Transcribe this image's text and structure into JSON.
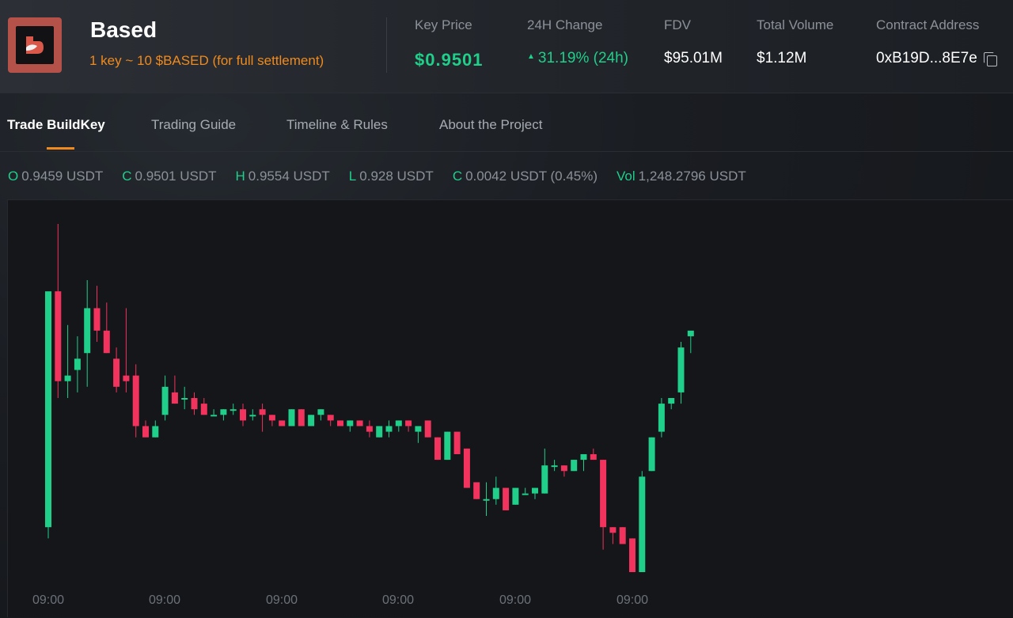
{
  "header": {
    "title": "Based",
    "subtitle": "1 key ~ 10 $BASED (for full settlement)",
    "stats": [
      {
        "label": "Key Price",
        "value": "$0.9501"
      },
      {
        "label": "24H Change",
        "value": "31.19% (24h)"
      },
      {
        "label": "FDV",
        "value": "$95.01M"
      },
      {
        "label": "Total Volume",
        "value": "$1.12M"
      },
      {
        "label": "Contract Address",
        "value": "0xB19D...8E7e"
      }
    ]
  },
  "tabs": [
    {
      "label": "Trade BuildKey",
      "active": true
    },
    {
      "label": "Trading Guide",
      "active": false
    },
    {
      "label": "Timeline & Rules",
      "active": false
    },
    {
      "label": "About the Project",
      "active": false
    }
  ],
  "ohlc": {
    "open": {
      "key": "O",
      "value": "0.9459 USDT"
    },
    "close": {
      "key": "C",
      "value": "0.9501 USDT"
    },
    "high": {
      "key": "H",
      "value": "0.9554 USDT"
    },
    "low": {
      "key": "L",
      "value": "0.928 USDT"
    },
    "change": {
      "key": "C",
      "value": "0.0042 USDT (0.45%)"
    },
    "volume": {
      "key": "Vol",
      "value": "1,248.2796 USDT"
    }
  },
  "colors": {
    "up": "#1fcf8a",
    "down": "#f2335d",
    "accent": "#f08a1c",
    "logo": "#b4524a"
  },
  "chart_data": {
    "type": "candlestick",
    "x_tick_labels": [
      "09:00",
      "09:00",
      "09:00",
      "09:00",
      "09:00",
      "09:00"
    ],
    "candles": [
      {
        "o": 0.7,
        "h": 0.99,
        "l": 0.68,
        "c": 1.12
      },
      {
        "o": 1.12,
        "h": 1.24,
        "l": 0.93,
        "c": 0.96
      },
      {
        "o": 0.96,
        "h": 1.06,
        "l": 0.93,
        "c": 0.97
      },
      {
        "o": 0.98,
        "h": 1.04,
        "l": 0.94,
        "c": 1.0
      },
      {
        "o": 1.01,
        "h": 1.14,
        "l": 0.95,
        "c": 1.09
      },
      {
        "o": 1.09,
        "h": 1.13,
        "l": 1.03,
        "c": 1.05
      },
      {
        "o": 1.05,
        "h": 1.1,
        "l": 1.01,
        "c": 1.01
      },
      {
        "o": 1.0,
        "h": 1.02,
        "l": 0.94,
        "c": 0.95
      },
      {
        "o": 0.97,
        "h": 1.09,
        "l": 0.94,
        "c": 0.96
      },
      {
        "o": 0.97,
        "h": 0.99,
        "l": 0.86,
        "c": 0.88
      },
      {
        "o": 0.88,
        "h": 0.89,
        "l": 0.86,
        "c": 0.86
      },
      {
        "o": 0.86,
        "h": 0.89,
        "l": 0.86,
        "c": 0.88
      },
      {
        "o": 0.9,
        "h": 0.97,
        "l": 0.89,
        "c": 0.95
      },
      {
        "o": 0.94,
        "h": 0.97,
        "l": 0.92,
        "c": 0.92
      },
      {
        "o": 0.93,
        "h": 0.95,
        "l": 0.91,
        "c": 0.93
      },
      {
        "o": 0.93,
        "h": 0.94,
        "l": 0.9,
        "c": 0.91
      },
      {
        "o": 0.92,
        "h": 0.93,
        "l": 0.9,
        "c": 0.9
      },
      {
        "o": 0.9,
        "h": 0.91,
        "l": 0.9,
        "c": 0.9
      },
      {
        "o": 0.9,
        "h": 0.91,
        "l": 0.89,
        "c": 0.91
      },
      {
        "o": 0.91,
        "h": 0.92,
        "l": 0.9,
        "c": 0.91
      },
      {
        "o": 0.91,
        "h": 0.92,
        "l": 0.88,
        "c": 0.89
      },
      {
        "o": 0.9,
        "h": 0.91,
        "l": 0.89,
        "c": 0.9
      },
      {
        "o": 0.91,
        "h": 0.92,
        "l": 0.87,
        "c": 0.9
      },
      {
        "o": 0.9,
        "h": 0.9,
        "l": 0.88,
        "c": 0.89
      },
      {
        "o": 0.89,
        "h": 0.89,
        "l": 0.88,
        "c": 0.88
      },
      {
        "o": 0.88,
        "h": 0.91,
        "l": 0.88,
        "c": 0.91
      },
      {
        "o": 0.91,
        "h": 0.91,
        "l": 0.88,
        "c": 0.88
      },
      {
        "o": 0.88,
        "h": 0.9,
        "l": 0.88,
        "c": 0.9
      },
      {
        "o": 0.9,
        "h": 0.91,
        "l": 0.89,
        "c": 0.91
      },
      {
        "o": 0.9,
        "h": 0.9,
        "l": 0.88,
        "c": 0.89
      },
      {
        "o": 0.89,
        "h": 0.89,
        "l": 0.88,
        "c": 0.88
      },
      {
        "o": 0.88,
        "h": 0.89,
        "l": 0.87,
        "c": 0.89
      },
      {
        "o": 0.89,
        "h": 0.89,
        "l": 0.88,
        "c": 0.88
      },
      {
        "o": 0.88,
        "h": 0.89,
        "l": 0.86,
        "c": 0.87
      },
      {
        "o": 0.86,
        "h": 0.88,
        "l": 0.86,
        "c": 0.88
      },
      {
        "o": 0.87,
        "h": 0.89,
        "l": 0.86,
        "c": 0.88
      },
      {
        "o": 0.88,
        "h": 0.89,
        "l": 0.87,
        "c": 0.89
      },
      {
        "o": 0.89,
        "h": 0.89,
        "l": 0.87,
        "c": 0.88
      },
      {
        "o": 0.87,
        "h": 0.88,
        "l": 0.85,
        "c": 0.88
      },
      {
        "o": 0.89,
        "h": 0.89,
        "l": 0.86,
        "c": 0.86
      },
      {
        "o": 0.86,
        "h": 0.86,
        "l": 0.82,
        "c": 0.82
      },
      {
        "o": 0.82,
        "h": 0.87,
        "l": 0.82,
        "c": 0.87
      },
      {
        "o": 0.87,
        "h": 0.87,
        "l": 0.83,
        "c": 0.83
      },
      {
        "o": 0.84,
        "h": 0.84,
        "l": 0.77,
        "c": 0.77
      },
      {
        "o": 0.78,
        "h": 0.78,
        "l": 0.75,
        "c": 0.75
      },
      {
        "o": 0.75,
        "h": 0.78,
        "l": 0.72,
        "c": 0.75
      },
      {
        "o": 0.75,
        "h": 0.79,
        "l": 0.74,
        "c": 0.77
      },
      {
        "o": 0.77,
        "h": 0.77,
        "l": 0.73,
        "c": 0.73
      },
      {
        "o": 0.74,
        "h": 0.77,
        "l": 0.74,
        "c": 0.77
      },
      {
        "o": 0.76,
        "h": 0.77,
        "l": 0.76,
        "c": 0.76
      },
      {
        "o": 0.76,
        "h": 0.77,
        "l": 0.75,
        "c": 0.77
      },
      {
        "o": 0.76,
        "h": 0.84,
        "l": 0.76,
        "c": 0.81
      },
      {
        "o": 0.81,
        "h": 0.82,
        "l": 0.8,
        "c": 0.81
      },
      {
        "o": 0.81,
        "h": 0.81,
        "l": 0.79,
        "c": 0.8
      },
      {
        "o": 0.8,
        "h": 0.82,
        "l": 0.8,
        "c": 0.82
      },
      {
        "o": 0.82,
        "h": 0.83,
        "l": 0.8,
        "c": 0.83
      },
      {
        "o": 0.83,
        "h": 0.84,
        "l": 0.82,
        "c": 0.82
      },
      {
        "o": 0.82,
        "h": 0.82,
        "l": 0.66,
        "c": 0.7
      },
      {
        "o": 0.7,
        "h": 0.7,
        "l": 0.67,
        "c": 0.69
      },
      {
        "o": 0.7,
        "h": 0.7,
        "l": 0.67,
        "c": 0.67
      },
      {
        "o": 0.68,
        "h": 0.68,
        "l": 0.62,
        "c": 0.62
      },
      {
        "o": 0.62,
        "h": 0.8,
        "l": 0.62,
        "c": 0.79
      },
      {
        "o": 0.8,
        "h": 0.86,
        "l": 0.8,
        "c": 0.86
      },
      {
        "o": 0.87,
        "h": 0.93,
        "l": 0.86,
        "c": 0.92
      },
      {
        "o": 0.92,
        "h": 0.93,
        "l": 0.91,
        "c": 0.93
      },
      {
        "o": 0.94,
        "h": 1.03,
        "l": 0.92,
        "c": 1.02
      },
      {
        "o": 1.04,
        "h": 1.04,
        "l": 1.01,
        "c": 1.05
      }
    ]
  }
}
